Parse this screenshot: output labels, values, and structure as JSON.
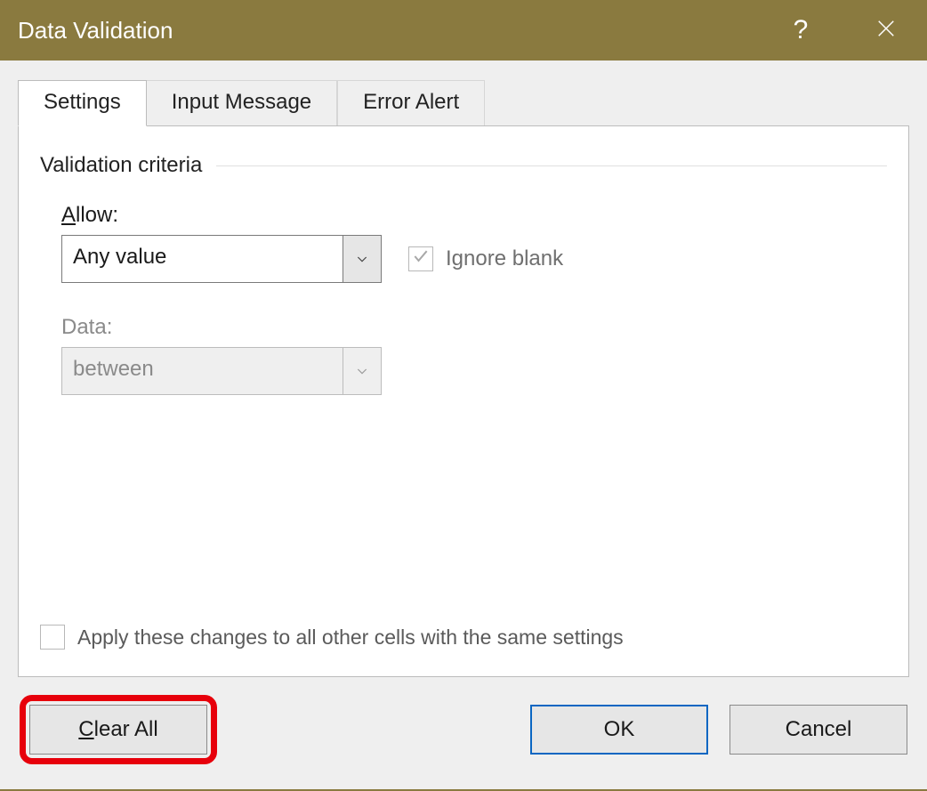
{
  "titlebar": {
    "title": "Data Validation",
    "help": "?",
    "close_icon": "close-icon"
  },
  "tabs": {
    "settings": "Settings",
    "input_message": "Input Message",
    "error_alert": "Error Alert",
    "active": "settings"
  },
  "group": {
    "title": "Validation criteria"
  },
  "allow": {
    "label_pre": "A",
    "label_post": "llow:",
    "value": "Any value",
    "enabled": true
  },
  "ignore_blank": {
    "label": "Ignore blank",
    "checked": true,
    "enabled": false
  },
  "data": {
    "label": "Data:",
    "value": "between",
    "enabled": false
  },
  "apply_all": {
    "label": "Apply these changes to all other cells with the same settings",
    "checked": false,
    "enabled": false
  },
  "buttons": {
    "clear_all_pre": "C",
    "clear_all_post": "lear All",
    "ok": "OK",
    "cancel": "Cancel"
  },
  "annotation": {
    "clear_all_highlighted": true
  }
}
